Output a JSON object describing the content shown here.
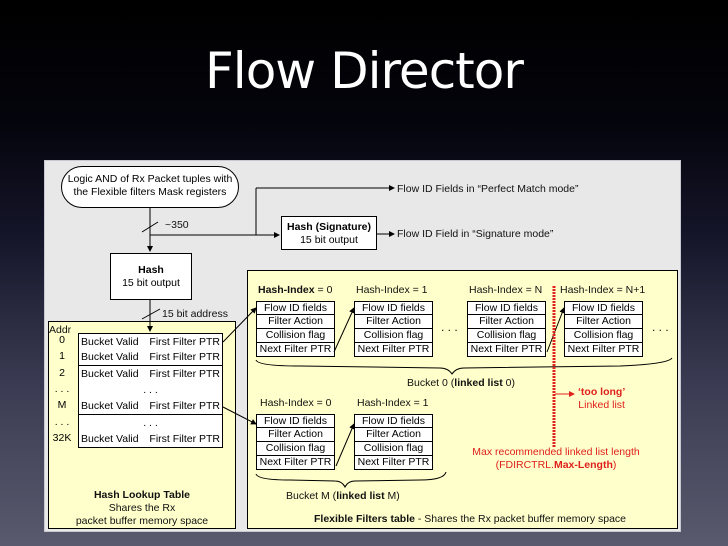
{
  "slide": {
    "title": "Flow Director"
  },
  "colors": {
    "panel_bg": "#e8e8e8",
    "table_bg": "#ffffcc",
    "limit_red": "#e0201c"
  },
  "input": {
    "label": "Logic AND of Rx Packet tuples with the Flexible filters Mask registers",
    "bus_width": "~350"
  },
  "hash_signature": {
    "title": "Hash (Signature)",
    "subtitle": "15 bit output"
  },
  "hash_main": {
    "title": "Hash",
    "subtitle": "15 bit output",
    "address_label": "15 bit address"
  },
  "outputs": {
    "perfect_match": "Flow ID Fields in “Perfect Match mode”",
    "signature": "Flow ID Field in “Signature mode”"
  },
  "hash_lookup_table": {
    "addr_header": "Addr",
    "rows": [
      {
        "addr": "0",
        "valid": "Bucket Valid",
        "ptr": "First Filter PTR"
      },
      {
        "addr": "1",
        "valid": "Bucket Valid",
        "ptr": "First Filter PTR"
      },
      {
        "addr": "2",
        "valid": "Bucket Valid",
        "ptr": "First Filter PTR"
      },
      {
        "addr": ". . .",
        "ellipsis": ". . ."
      },
      {
        "addr": "M",
        "valid": "Bucket Valid",
        "ptr": "First Filter PTR"
      },
      {
        "addr": ". . .",
        "ellipsis": ". . ."
      },
      {
        "addr": "32K",
        "valid": "Bucket Valid",
        "ptr": "First Filter PTR"
      }
    ],
    "title": "Hash Lookup Table",
    "caption_line1": "Shares the Rx",
    "caption_line2": "packet buffer memory space"
  },
  "flexible_filters": {
    "record_fields": [
      "Flow ID fields",
      "Filter Action",
      "Collision flag",
      "Next Filter PTR"
    ],
    "bucket0": {
      "headers": [
        {
          "bold": "Hash-Index",
          "rest": " = 0"
        },
        {
          "bold": "",
          "rest": "Hash-Index = 1"
        },
        {
          "bold": "",
          "rest": "Hash-Index = N"
        },
        {
          "bold": "",
          "rest": "Hash-Index = N+1"
        }
      ],
      "label_pre": "Bucket 0 (",
      "label_bold": "linked list",
      "label_post": " 0)"
    },
    "bucketM": {
      "headers": [
        "Hash-Index = 0",
        "Hash-Index = 1"
      ],
      "label_pre": "Bucket M (",
      "label_bold": "linked list",
      "label_post": " M)"
    },
    "ellipsis": ". . .",
    "too_long_bold": "‘too long’",
    "too_long_rest": "Linked list",
    "max_len_line1": "Max recommended linked list length",
    "max_len_pre": "(FDIRCTRL.",
    "max_len_bold": "Max-Length",
    "max_len_post": ")",
    "title_bold": "Flexible Filters table",
    "title_rest": " - Shares the Rx packet buffer memory space"
  }
}
